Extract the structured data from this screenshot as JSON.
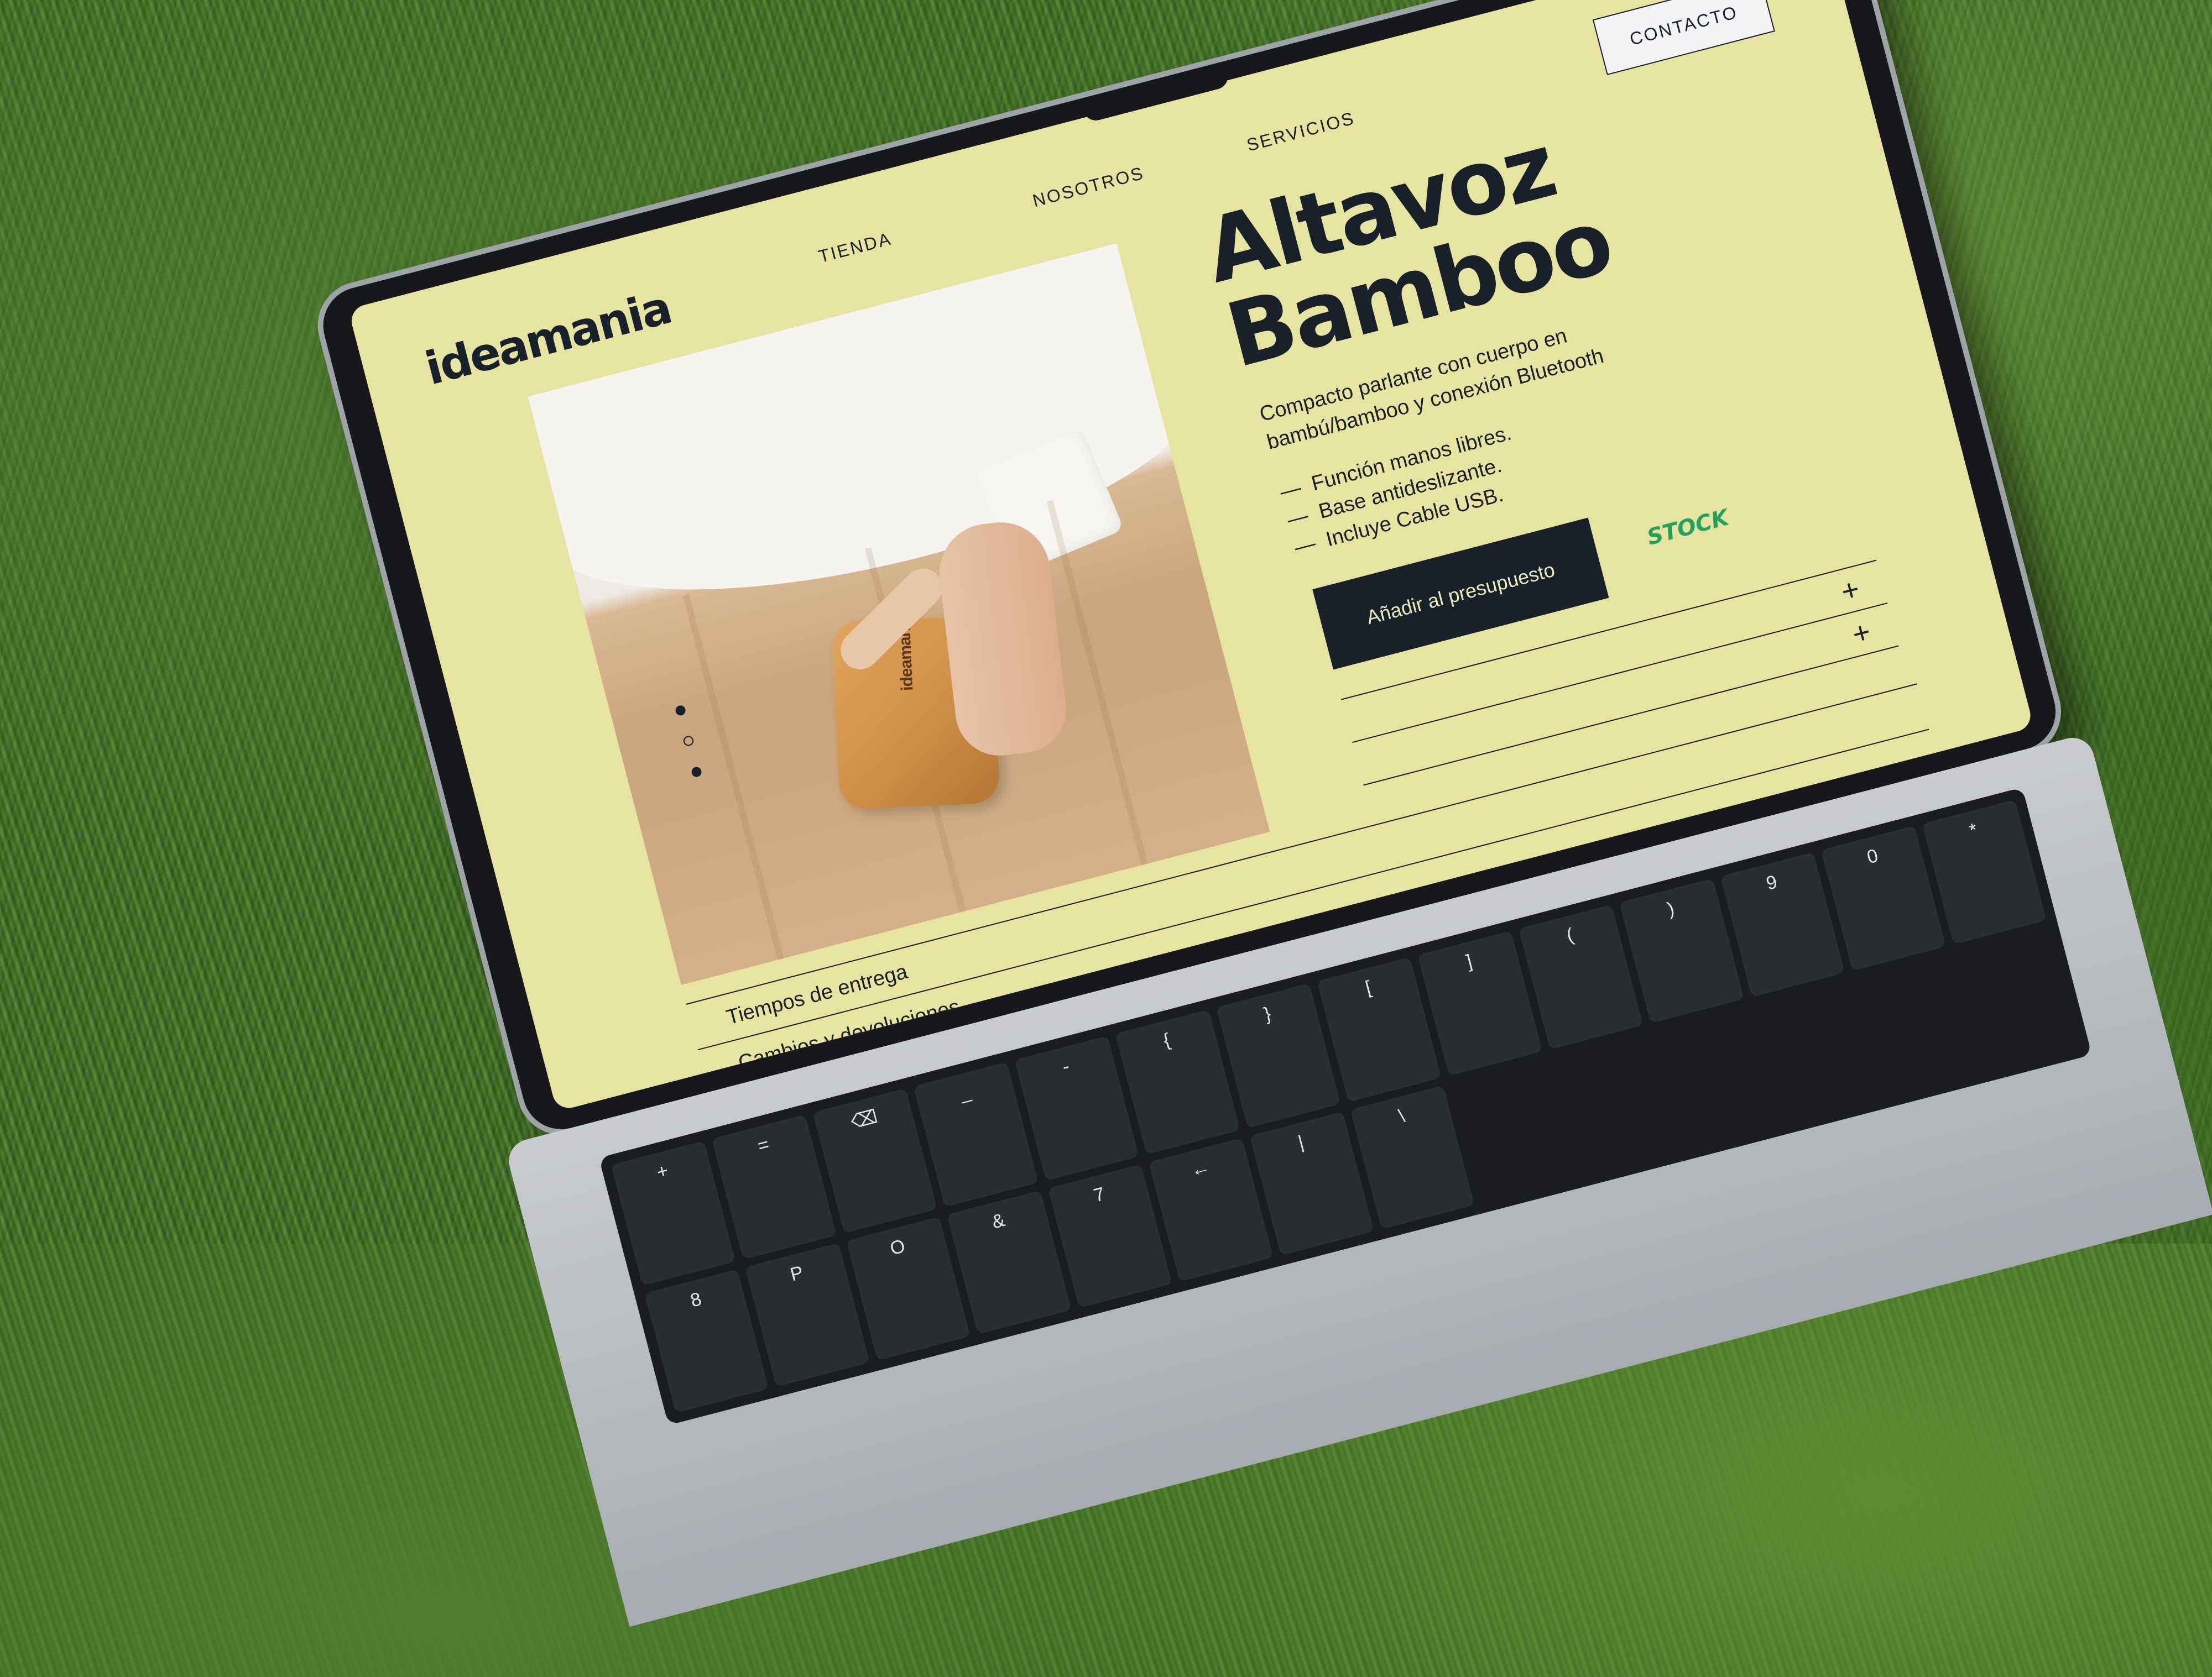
{
  "brand": {
    "logo": "ideamania",
    "speaker_print": "ideamania"
  },
  "nav": {
    "tienda": "TIENDA",
    "nosotros": "NOSOTROS",
    "servicios": "SERVICIOS",
    "contact": "CONTACTO"
  },
  "product": {
    "title_line1": "Altavoz",
    "title_line2": "Bamboo",
    "description_line1": "Compacto parlante con cuerpo en",
    "description_line2": "bambú/bamboo y conexión Bluetooth",
    "features": [
      "Función manos libres.",
      "Base antideslizante.",
      "Incluye Cable USB."
    ],
    "add_button": "Añadir al presupuesto",
    "stock_label": "STOCK"
  },
  "accordion": {
    "item1": "Tiempos de entrega",
    "item2": "Cambios y devoluciones"
  },
  "icons": {
    "expand": "plus-icon",
    "slider_dot": "dot-icon"
  },
  "colors": {
    "screen_bg": "#e7e4a1",
    "primary": "#182029",
    "stock": "#1fa35e"
  },
  "keyboard": {
    "keys": [
      "+",
      "=",
      "⌫",
      "_",
      "-",
      "{",
      "}",
      "[",
      "]",
      "(",
      ")",
      "9",
      "0",
      "*",
      "8",
      "P",
      "O",
      "&",
      "7",
      "←",
      "|",
      "\\"
    ]
  }
}
